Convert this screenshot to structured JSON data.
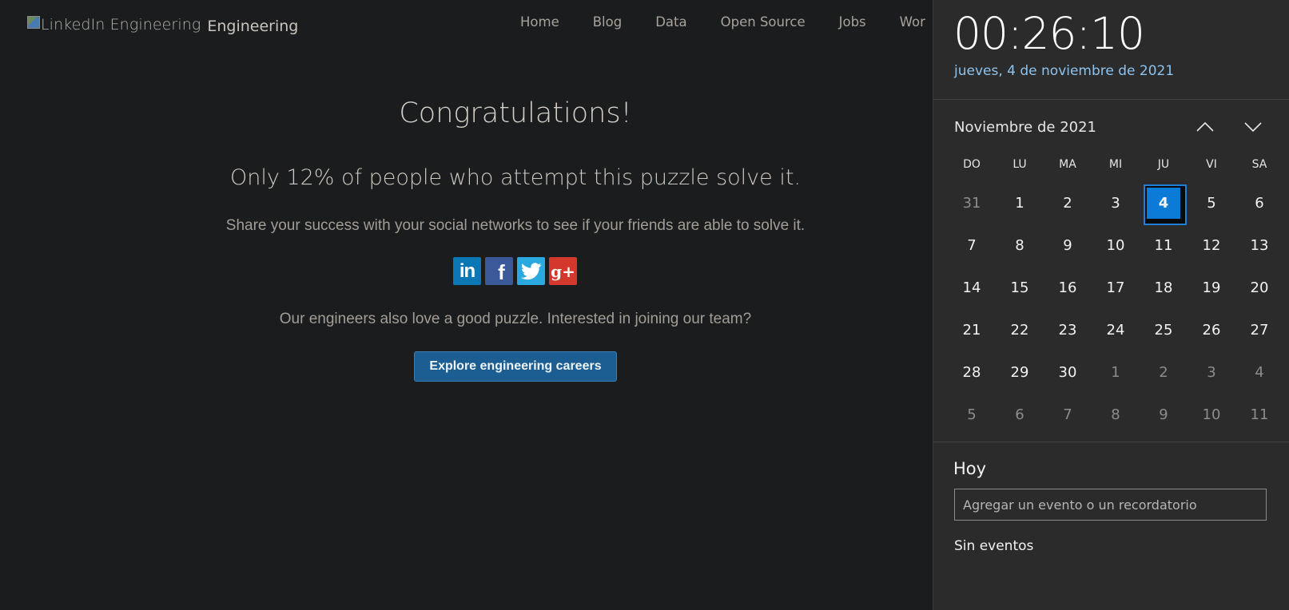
{
  "site": {
    "logo_alt": "LinkedIn Engineering",
    "brand": "Engineering",
    "nav": [
      "Home",
      "Blog",
      "Data",
      "Open Source",
      "Jobs",
      "Wor"
    ]
  },
  "hero": {
    "title": "Congratulations!",
    "subtitle": "Only 12% of people who attempt this puzzle solve it.",
    "share_text": "Share your success with your social networks to see if your friends are able to solve it.",
    "socials": [
      "in",
      "f",
      "twitter",
      "g+"
    ],
    "team_text": "Our engineers also love a good puzzle. Interested in joining our team?",
    "careers_button": "Explore engineering careers"
  },
  "calendar": {
    "clock": "00:26:10",
    "long_date": "jueves, 4 de noviembre de 2021",
    "month_title": "Noviembre de 2021",
    "weekdays": [
      "DO",
      "LU",
      "MA",
      "MI",
      "JU",
      "VI",
      "SA"
    ],
    "days": [
      {
        "d": "31",
        "other": true
      },
      {
        "d": "1"
      },
      {
        "d": "2"
      },
      {
        "d": "3"
      },
      {
        "d": "4",
        "today": true
      },
      {
        "d": "5"
      },
      {
        "d": "6"
      },
      {
        "d": "7"
      },
      {
        "d": "8"
      },
      {
        "d": "9"
      },
      {
        "d": "10"
      },
      {
        "d": "11"
      },
      {
        "d": "12"
      },
      {
        "d": "13"
      },
      {
        "d": "14"
      },
      {
        "d": "15"
      },
      {
        "d": "16"
      },
      {
        "d": "17"
      },
      {
        "d": "18"
      },
      {
        "d": "19"
      },
      {
        "d": "20"
      },
      {
        "d": "21"
      },
      {
        "d": "22"
      },
      {
        "d": "23"
      },
      {
        "d": "24"
      },
      {
        "d": "25"
      },
      {
        "d": "26"
      },
      {
        "d": "27"
      },
      {
        "d": "28"
      },
      {
        "d": "29"
      },
      {
        "d": "30"
      },
      {
        "d": "1",
        "other": true
      },
      {
        "d": "2",
        "other": true
      },
      {
        "d": "3",
        "other": true
      },
      {
        "d": "4",
        "other": true
      },
      {
        "d": "5",
        "other": true
      },
      {
        "d": "6",
        "other": true
      },
      {
        "d": "7",
        "other": true
      },
      {
        "d": "8",
        "other": true
      },
      {
        "d": "9",
        "other": true
      },
      {
        "d": "10",
        "other": true
      },
      {
        "d": "11",
        "other": true
      }
    ],
    "today_heading": "Hoy",
    "event_placeholder": "Agregar un evento o un recordatorio",
    "no_events": "Sin eventos"
  },
  "colors": {
    "page_bg": "#1b1c1e",
    "flyout_bg": "#2b2b2b",
    "accent": "#0c7bd8",
    "date_link": "#8cc3ef",
    "careers_button": "#1d5e92"
  }
}
